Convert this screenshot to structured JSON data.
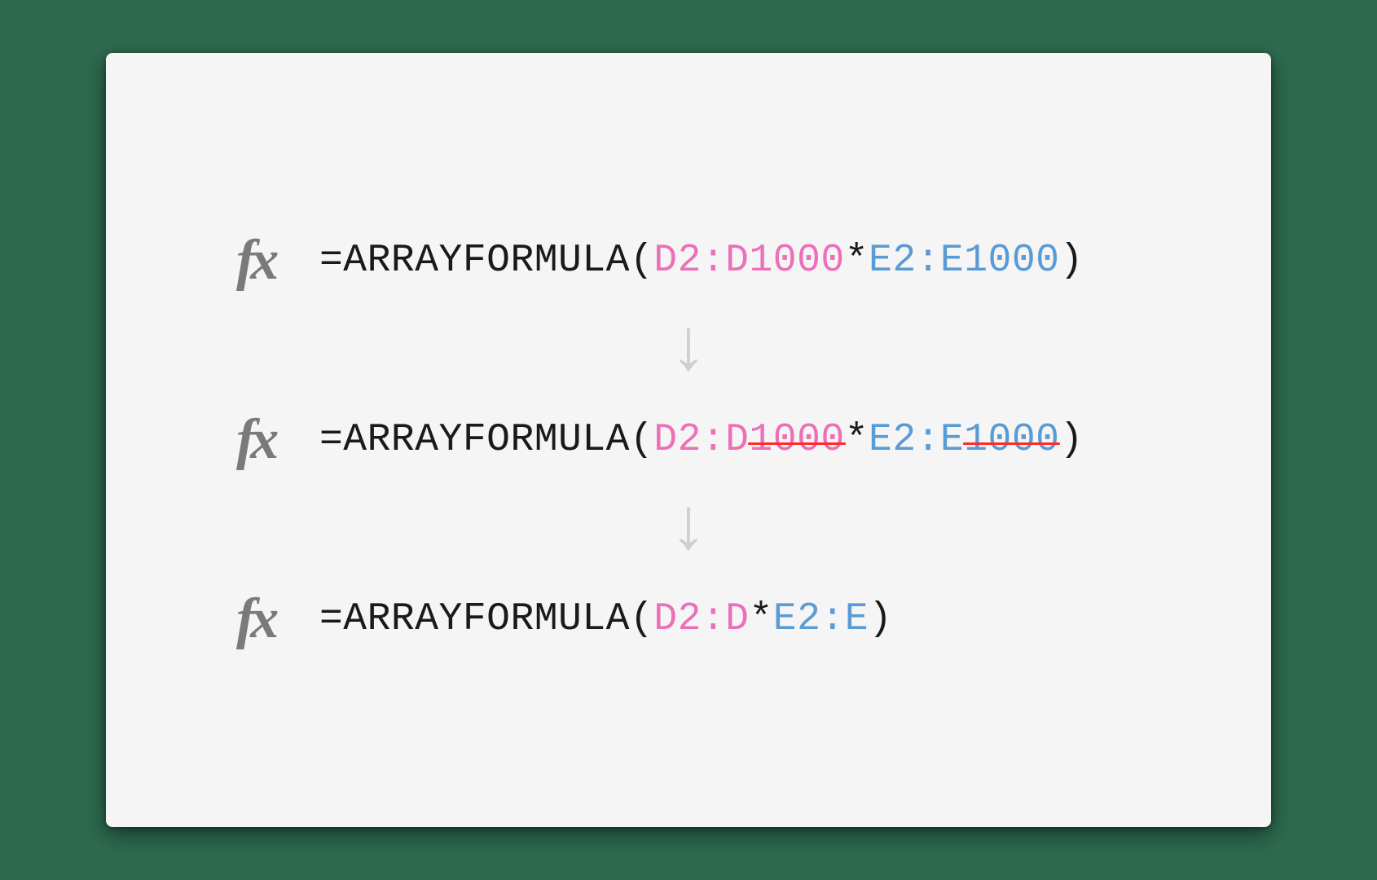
{
  "fx_label": "fx",
  "arrow_glyph": "↓",
  "formulas": [
    {
      "tokens": [
        {
          "text": "=ARRAYFORMULA(",
          "cls": "tok-black",
          "strike": false
        },
        {
          "text": "D2:D1000",
          "cls": "tok-pink",
          "strike": false
        },
        {
          "text": "*",
          "cls": "tok-black",
          "strike": false
        },
        {
          "text": "E2:E1000",
          "cls": "tok-blue",
          "strike": false
        },
        {
          "text": ")",
          "cls": "tok-black",
          "strike": false
        }
      ]
    },
    {
      "tokens": [
        {
          "text": "=ARRAYFORMULA(",
          "cls": "tok-black",
          "strike": false
        },
        {
          "text": "D2:D",
          "cls": "tok-pink",
          "strike": false
        },
        {
          "text": "1000",
          "cls": "tok-pink",
          "strike": true
        },
        {
          "text": "*",
          "cls": "tok-black",
          "strike": false
        },
        {
          "text": "E2:E",
          "cls": "tok-blue",
          "strike": false
        },
        {
          "text": "1000",
          "cls": "tok-blue",
          "strike": true
        },
        {
          "text": ")",
          "cls": "tok-black",
          "strike": false
        }
      ]
    },
    {
      "tokens": [
        {
          "text": "=ARRAYFORMULA(",
          "cls": "tok-black",
          "strike": false
        },
        {
          "text": "D2:D",
          "cls": "tok-pink",
          "strike": false
        },
        {
          "text": "*",
          "cls": "tok-black",
          "strike": false
        },
        {
          "text": "E2:E",
          "cls": "tok-blue",
          "strike": false
        },
        {
          "text": ")",
          "cls": "tok-black",
          "strike": false
        }
      ]
    }
  ]
}
